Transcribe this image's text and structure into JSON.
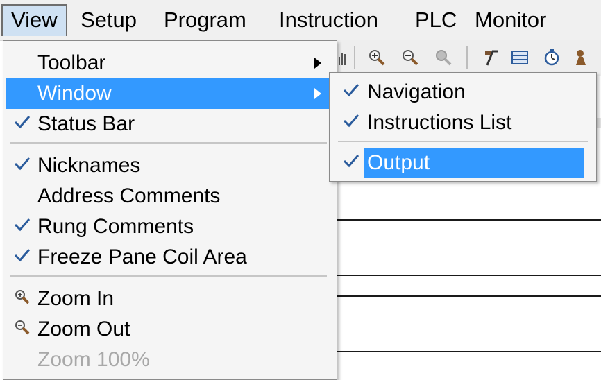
{
  "menubar": {
    "items": [
      {
        "label": "View",
        "open": true
      },
      {
        "label": "Setup"
      },
      {
        "label": "Program"
      },
      {
        "label": "Instruction"
      },
      {
        "label": "PLC"
      },
      {
        "label": "Monitor"
      }
    ]
  },
  "view_menu": {
    "items": [
      {
        "label": "Toolbar",
        "submenu": true
      },
      {
        "label": "Window",
        "submenu": true,
        "highlighted": true
      },
      {
        "label": "Status Bar",
        "checked": true
      },
      {
        "label": "Nicknames",
        "checked": true
      },
      {
        "label": "Address Comments",
        "checked": false
      },
      {
        "label": "Rung Comments",
        "checked": true
      },
      {
        "label": "Freeze Pane Coil Area",
        "checked": true
      },
      {
        "label": "Zoom In",
        "icon": "zoom-in-icon"
      },
      {
        "label": "Zoom Out",
        "icon": "zoom-out-icon"
      },
      {
        "label": "Zoom 100%",
        "disabled": true
      }
    ]
  },
  "window_submenu": {
    "items": [
      {
        "label": "Navigation",
        "checked": true
      },
      {
        "label": "Instructions List",
        "checked": true
      },
      {
        "label": "Output",
        "checked": true,
        "highlighted": true
      }
    ]
  },
  "colors": {
    "highlight": "#3399ff",
    "open_menu_bg": "#cfe1f3",
    "check": "#2a5b9c",
    "disabled_text": "#a8a8a8"
  }
}
